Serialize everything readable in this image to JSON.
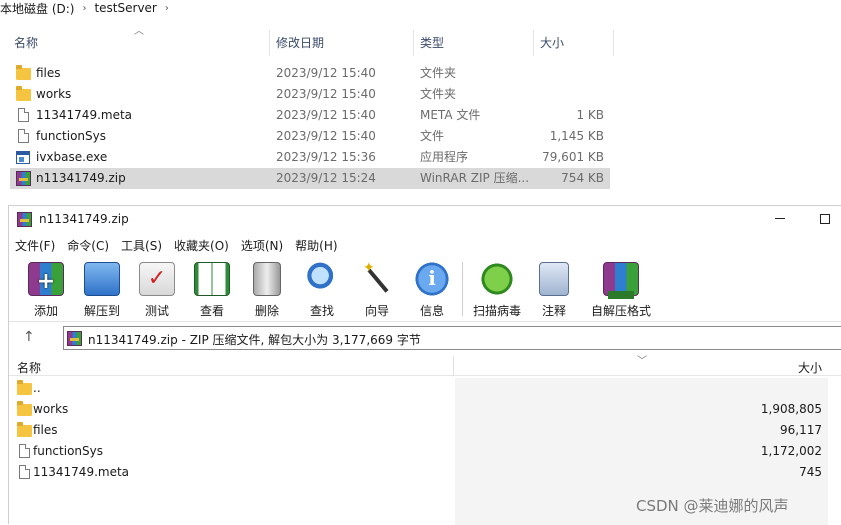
{
  "breadcrumb": {
    "drive": "本地磁盘 (D:)",
    "folder": "testServer"
  },
  "explorer": {
    "columns": {
      "name": "名称",
      "date": "修改日期",
      "type": "类型",
      "size": "大小"
    },
    "rows": [
      {
        "icon": "folder-icon",
        "name": "files",
        "date": "2023/9/12 15:40",
        "type": "文件夹",
        "size": ""
      },
      {
        "icon": "folder-icon",
        "name": "works",
        "date": "2023/9/12 15:40",
        "type": "文件夹",
        "size": ""
      },
      {
        "icon": "file-icon",
        "name": "11341749.meta",
        "date": "2023/9/12 15:40",
        "type": "META 文件",
        "size": "1 KB"
      },
      {
        "icon": "file-icon",
        "name": "functionSys",
        "date": "2023/9/12 15:40",
        "type": "文件",
        "size": "1,145 KB"
      },
      {
        "icon": "exe-icon",
        "name": "ivxbase.exe",
        "date": "2023/9/12 15:36",
        "type": "应用程序",
        "size": "79,601 KB"
      },
      {
        "icon": "winrar-archive-icon",
        "name": "n11341749.zip",
        "date": "2023/9/12 15:24",
        "type": "WinRAR ZIP 压缩...",
        "size": "754 KB",
        "selected": true
      }
    ]
  },
  "winrar": {
    "title": "n11341749.zip",
    "menu": [
      "文件(F)",
      "命令(C)",
      "工具(S)",
      "收藏夹(O)",
      "选项(N)",
      "帮助(H)"
    ],
    "toolbar": [
      {
        "id": "add",
        "label": "添加",
        "icon": "add-archive-icon"
      },
      {
        "id": "extract",
        "label": "解压到",
        "icon": "extract-to-icon"
      },
      {
        "id": "test",
        "label": "测试",
        "icon": "test-icon"
      },
      {
        "id": "view",
        "label": "查看",
        "icon": "view-book-icon"
      },
      {
        "id": "delete",
        "label": "删除",
        "icon": "trash-icon"
      },
      {
        "id": "find",
        "label": "查找",
        "icon": "magnifier-icon"
      },
      {
        "id": "wizard",
        "label": "向导",
        "icon": "wizard-wand-icon"
      },
      {
        "id": "info",
        "label": "信息",
        "icon": "info-icon"
      },
      {
        "id": "virus",
        "label": "扫描病毒",
        "icon": "virus-scan-icon"
      },
      {
        "id": "comment",
        "label": "注释",
        "icon": "comment-icon"
      },
      {
        "id": "sfx",
        "label": "自解压格式",
        "icon": "sfx-icon"
      }
    ],
    "path": "n11341749.zip - ZIP 压缩文件, 解包大小为 3,177,669 字节",
    "columns": {
      "name": "名称",
      "size": "大小"
    },
    "rows": [
      {
        "icon": "folder-icon",
        "name": "..",
        "size": ""
      },
      {
        "icon": "folder-icon",
        "name": "works",
        "size": "1,908,805"
      },
      {
        "icon": "folder-icon",
        "name": "files",
        "size": "96,117"
      },
      {
        "icon": "file-icon",
        "name": "functionSys",
        "size": "1,172,002"
      },
      {
        "icon": "file-icon",
        "name": "11341749.meta",
        "size": "745"
      }
    ]
  },
  "watermark": "CSDN @莱迪娜的风声"
}
